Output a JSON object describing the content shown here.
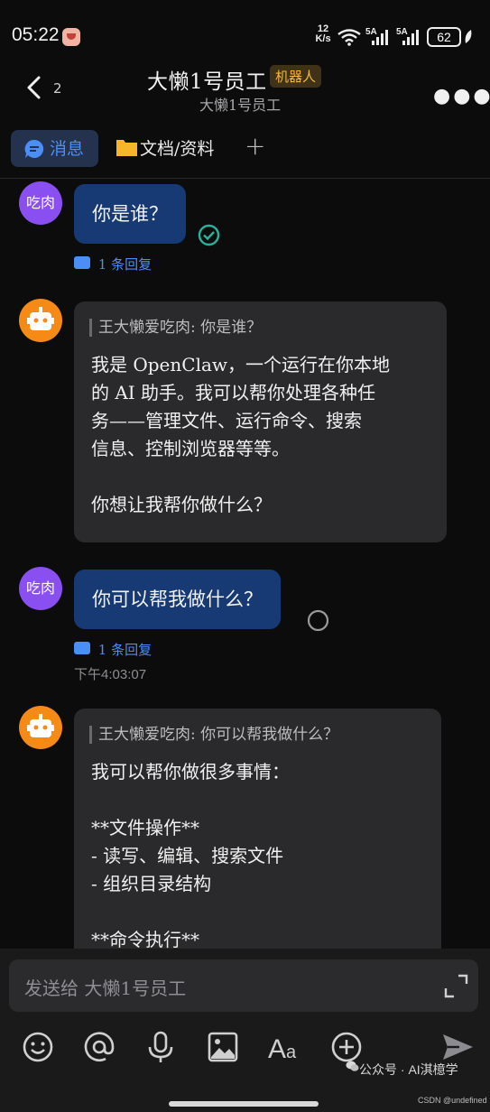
{
  "status_bar": {
    "time": "05:22",
    "net_speed_top": "12",
    "net_speed_bottom": "K/s",
    "signal1_label": "5A",
    "signal2_label": "5A",
    "battery": "62"
  },
  "header": {
    "back_count": "2",
    "title": "大懒1号员工",
    "tag": "机器人",
    "subtitle": "大懒1号员工"
  },
  "tabs": [
    {
      "label": "消息",
      "active": true
    },
    {
      "label": "文档/资料",
      "active": false
    }
  ],
  "messages": [
    {
      "sender": "user",
      "avatar_text": "吃肉",
      "text": "你是谁？",
      "reply_label": "1 条回复",
      "status": "read"
    },
    {
      "sender": "bot",
      "quote": "王大懒爱吃肉: 你是谁？",
      "text": "我是 OpenClaw，一个运行在你本地\n的 AI 助手。我可以帮你处理各种任\n务——管理文件、运行命令、搜索\n信息、控制浏览器等等。\n\n你想让我帮你做什么？"
    },
    {
      "sender": "user",
      "avatar_text": "吃肉",
      "text": "你可以帮我做什么？",
      "reply_label": "1 条回复",
      "time": "下午4:03:07",
      "status": "pending"
    },
    {
      "sender": "bot",
      "quote": "王大懒爱吃肉: 你可以帮我做什么？",
      "text": "我可以帮你做很多事情：\n\n**文件操作**\n- 读写、编辑、搜索文件\n- 组织目录结构\n\n**命令执行**"
    }
  ],
  "composer": {
    "placeholder": "发送给 大懒1号员工"
  },
  "toolbar": [
    "emoji-icon",
    "mention-icon",
    "mic-icon",
    "image-icon",
    "text-format-icon",
    "add-icon",
    "send-icon"
  ],
  "watermark": {
    "text": "公众号 · AI淇檍学",
    "csdn": "CSDN @undefined"
  },
  "colors": {
    "accent": "#4b8ef5",
    "user_bubble": "#173a74",
    "bot_bubble": "#2a2a2c",
    "user_avatar": "#8a4ff0",
    "bot_avatar": "#f58a16",
    "tag_text": "#f4b73a"
  }
}
